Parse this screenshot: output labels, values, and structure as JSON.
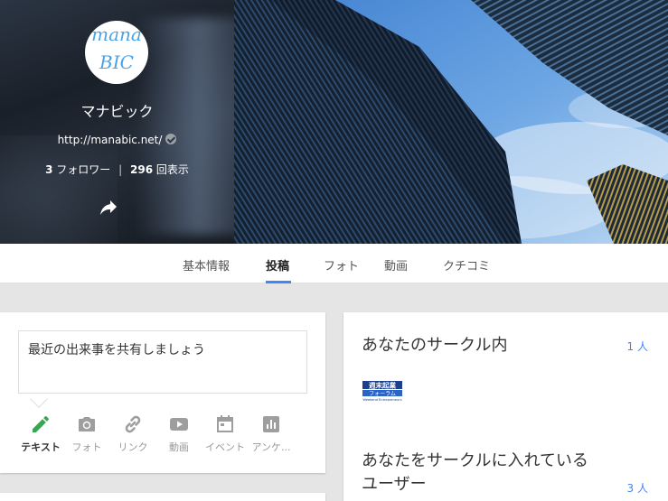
{
  "profile": {
    "avatar_line1": "mana",
    "avatar_line2": "BIC",
    "name": "マナビック",
    "url": "http://manabic.net/",
    "followers_count": "3",
    "followers_label": "フォロワー",
    "views_count": "296",
    "views_label": "回表示",
    "separator": "|"
  },
  "tabs": [
    {
      "label": "基本情報",
      "active": false
    },
    {
      "label": "投稿",
      "active": true
    },
    {
      "label": "フォト",
      "active": false
    },
    {
      "label": "動画",
      "active": false
    },
    {
      "label": "クチコミ",
      "active": false
    }
  ],
  "composer": {
    "placeholder": "最近の出来事を共有しましょう",
    "tools": [
      {
        "label": "テキスト",
        "icon": "pencil-icon",
        "active": true
      },
      {
        "label": "フォト",
        "icon": "camera-icon",
        "active": false
      },
      {
        "label": "リンク",
        "icon": "link-icon",
        "active": false
      },
      {
        "label": "動画",
        "icon": "video-icon",
        "active": false
      },
      {
        "label": "イベント",
        "icon": "calendar-icon",
        "active": false
      },
      {
        "label": "アンケ...",
        "icon": "poll-icon",
        "active": false
      }
    ]
  },
  "circles": {
    "in_your_circles_title": "あなたのサークル内",
    "in_your_circles_count": "1 人",
    "logo_alt": "週末起業フォーラム",
    "logo_line1": "週末起業",
    "logo_line2": "フォーラム",
    "logo_line3": "Weekend Entrepreneurs",
    "have_you_in_circles_title": "あなたをサークルに入れているユーザー",
    "have_you_in_circles_count": "3 人"
  },
  "colors": {
    "accent": "#4285f4",
    "active_tool": "#34a853",
    "icon_gray": "#9e9e9e"
  }
}
